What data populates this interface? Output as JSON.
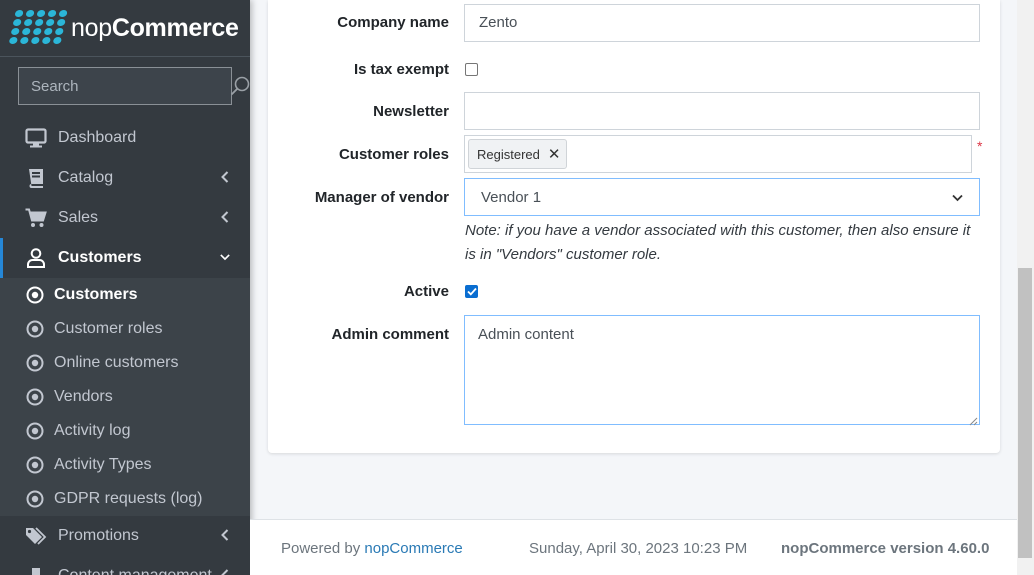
{
  "brand": {
    "name_light": "nop",
    "name_bold": "Commerce"
  },
  "search": {
    "placeholder": "Search"
  },
  "nav": {
    "items": [
      {
        "label": "Dashboard"
      },
      {
        "label": "Catalog"
      },
      {
        "label": "Sales"
      },
      {
        "label": "Customers"
      },
      {
        "label": "Promotions"
      },
      {
        "label": "Content management"
      }
    ],
    "customers_sub": [
      {
        "label": "Customers"
      },
      {
        "label": "Customer roles"
      },
      {
        "label": "Online customers"
      },
      {
        "label": "Vendors"
      },
      {
        "label": "Activity log"
      },
      {
        "label": "Activity Types"
      },
      {
        "label": "GDPR requests (log)"
      }
    ]
  },
  "form": {
    "company_name": {
      "label": "Company name",
      "value": "Zento"
    },
    "tax_exempt": {
      "label": "Is tax exempt",
      "checked": false
    },
    "newsletter": {
      "label": "Newsletter",
      "value": ""
    },
    "customer_roles": {
      "label": "Customer roles",
      "tags": [
        "Registered"
      ],
      "required_mark": "*"
    },
    "manager_of_vendor": {
      "label": "Manager of vendor",
      "value": "Vendor 1"
    },
    "vendor_note": "Note: if you have a vendor associated with this customer, then also ensure it is in \"Vendors\" customer role.",
    "active": {
      "label": "Active",
      "checked": true
    },
    "admin_comment": {
      "label": "Admin comment",
      "value": "Admin content"
    }
  },
  "footer": {
    "powered_by": "Powered by",
    "powered_link": "nopCommerce",
    "datetime": "Sunday, April 30, 2023 10:23 PM",
    "version": "nopCommerce version 4.60.0"
  },
  "colors": {
    "sidebar": "#343a40",
    "accent": "#2587d7",
    "brand": "#2bb6d8",
    "required": "#dc3545"
  }
}
